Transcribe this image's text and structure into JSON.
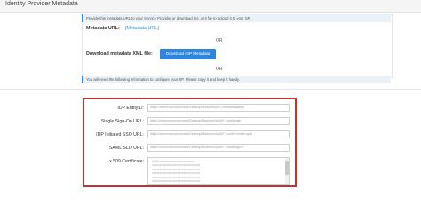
{
  "section": {
    "title": "Identity Provider Metadata"
  },
  "info": {
    "metadata_notice": "Provide this metadata URL to your Service Provider or download the .xml file to upload it to your SP.",
    "manual_notice": "You will need the following information to configure your SP. Please copy it and keep it handy."
  },
  "metadata": {
    "url_label": "Metadata URL:",
    "url_link": "[Metadata URL]",
    "or_1": "OR",
    "download_label": "Download metadata XML file:",
    "download_button": "Download IDP Metadata",
    "or_2": "OR"
  },
  "fields": [
    {
      "label": "IDP EntityID:",
      "value": "https://xxxxxxxxxxxxxxxxxx/Desktop/Modules/MVC/module/wambp"
    },
    {
      "label": "Single Sign-On URL:",
      "value": "https://xxxxxxxxxxxxxxxxxx/Desktop/Modules/idp/AP.../omtl/login"
    },
    {
      "label": "IDP Initiated SSO URL:",
      "value": "https://xxxxxxxxxxxxxxxxxx/Desktop/Modules/idp/AP.../omtl/?omtlid=spst"
    },
    {
      "label": "SAML SLO URL:",
      "value": "https://xxxxxxxxxxxxxxxxxx/Desktop/Modules/idp/AP.../omtl/logout"
    },
    {
      "label": "x.509 Certificate:",
      "value": "MIIDxxxxxxxxxxxxxxxxxxxxxxxx\nxxxxxxxxxxxxxxxxxxxxxxxxxxxxxxxx\nxxxxxxxxxxxxxxxxxxxxxxxxxxxxxxxx\nxxxxxxxxxxxxxxxxxxxxxxxxxxxxxxxx\nxxxxxxxxxxxxxxxxxxxxxxxxxxxxxxxx\nxxxxxxxxxxxxxxxxxxxxxxxxxxxxxxxx"
    }
  ],
  "colors": {
    "accent": "#2e86de",
    "highlight": "#c53030",
    "link": "#2f8ed8"
  }
}
